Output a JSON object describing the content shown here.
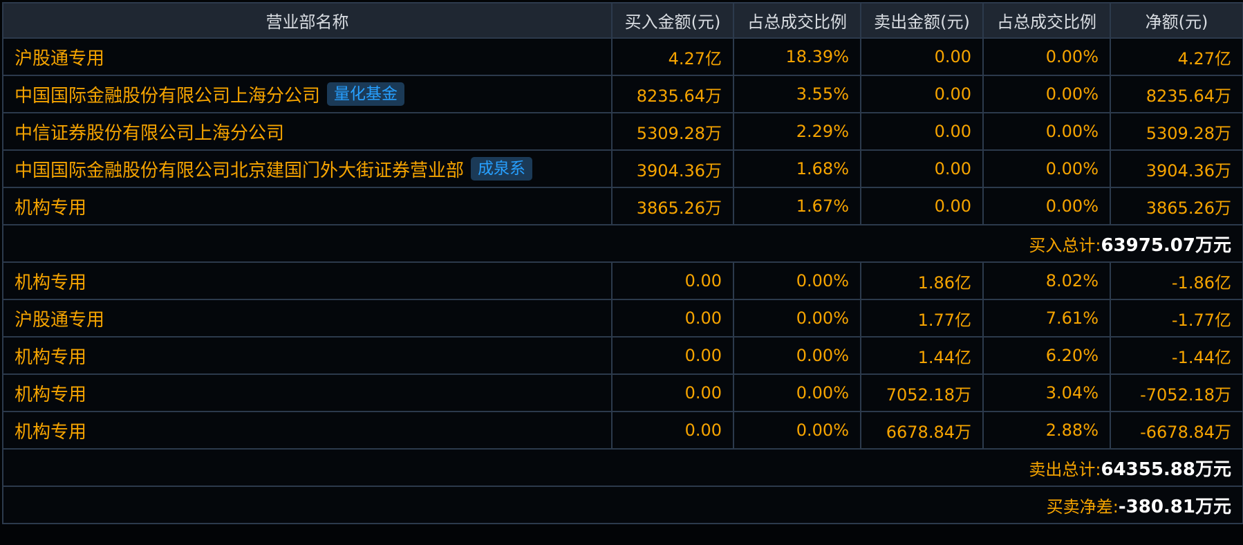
{
  "table": {
    "headers": [
      "营业部名称",
      "买入金额(元)",
      "占总成交比例",
      "卖出金额(元)",
      "占总成交比例",
      "净额(元)"
    ],
    "buy_rows": [
      {
        "name": "沪股通专用",
        "tag": "",
        "buy": "4.27亿",
        "buy_pct": "18.39%",
        "sell": "0.00",
        "sell_pct": "0.00%",
        "net": "4.27亿"
      },
      {
        "name": "中国国际金融股份有限公司上海分公司",
        "tag": "量化基金",
        "buy": "8235.64万",
        "buy_pct": "3.55%",
        "sell": "0.00",
        "sell_pct": "0.00%",
        "net": "8235.64万"
      },
      {
        "name": "中信证券股份有限公司上海分公司",
        "tag": "",
        "buy": "5309.28万",
        "buy_pct": "2.29%",
        "sell": "0.00",
        "sell_pct": "0.00%",
        "net": "5309.28万"
      },
      {
        "name": "中国国际金融股份有限公司北京建国门外大街证券营业部",
        "tag": "成泉系",
        "buy": "3904.36万",
        "buy_pct": "1.68%",
        "sell": "0.00",
        "sell_pct": "0.00%",
        "net": "3904.36万"
      },
      {
        "name": "机构专用",
        "tag": "",
        "buy": "3865.26万",
        "buy_pct": "1.67%",
        "sell": "0.00",
        "sell_pct": "0.00%",
        "net": "3865.26万"
      }
    ],
    "buy_total": {
      "label": "买入总计:",
      "value": "63975.07",
      "unit": "万元"
    },
    "sell_rows": [
      {
        "name": "机构专用",
        "tag": "",
        "buy": "0.00",
        "buy_pct": "0.00%",
        "sell": "1.86亿",
        "sell_pct": "8.02%",
        "net": "-1.86亿"
      },
      {
        "name": "沪股通专用",
        "tag": "",
        "buy": "0.00",
        "buy_pct": "0.00%",
        "sell": "1.77亿",
        "sell_pct": "7.61%",
        "net": "-1.77亿"
      },
      {
        "name": "机构专用",
        "tag": "",
        "buy": "0.00",
        "buy_pct": "0.00%",
        "sell": "1.44亿",
        "sell_pct": "6.20%",
        "net": "-1.44亿"
      },
      {
        "name": "机构专用",
        "tag": "",
        "buy": "0.00",
        "buy_pct": "0.00%",
        "sell": "7052.18万",
        "sell_pct": "3.04%",
        "net": "-7052.18万"
      },
      {
        "name": "机构专用",
        "tag": "",
        "buy": "0.00",
        "buy_pct": "0.00%",
        "sell": "6678.84万",
        "sell_pct": "2.88%",
        "net": "-6678.84万"
      }
    ],
    "sell_total": {
      "label": "卖出总计:",
      "value": "64355.88",
      "unit": "万元"
    },
    "net_total": {
      "label": "买卖净差:",
      "value": "-380.81",
      "unit": "万元"
    }
  },
  "colors": {
    "background": "#020406",
    "header_bg": "#1f2732",
    "grid": "#2c3a4c",
    "value_text": "#f6a400",
    "tag_text": "#27a0ff",
    "tag_bg": "#1b3a57",
    "total_text": "#ffffff"
  }
}
